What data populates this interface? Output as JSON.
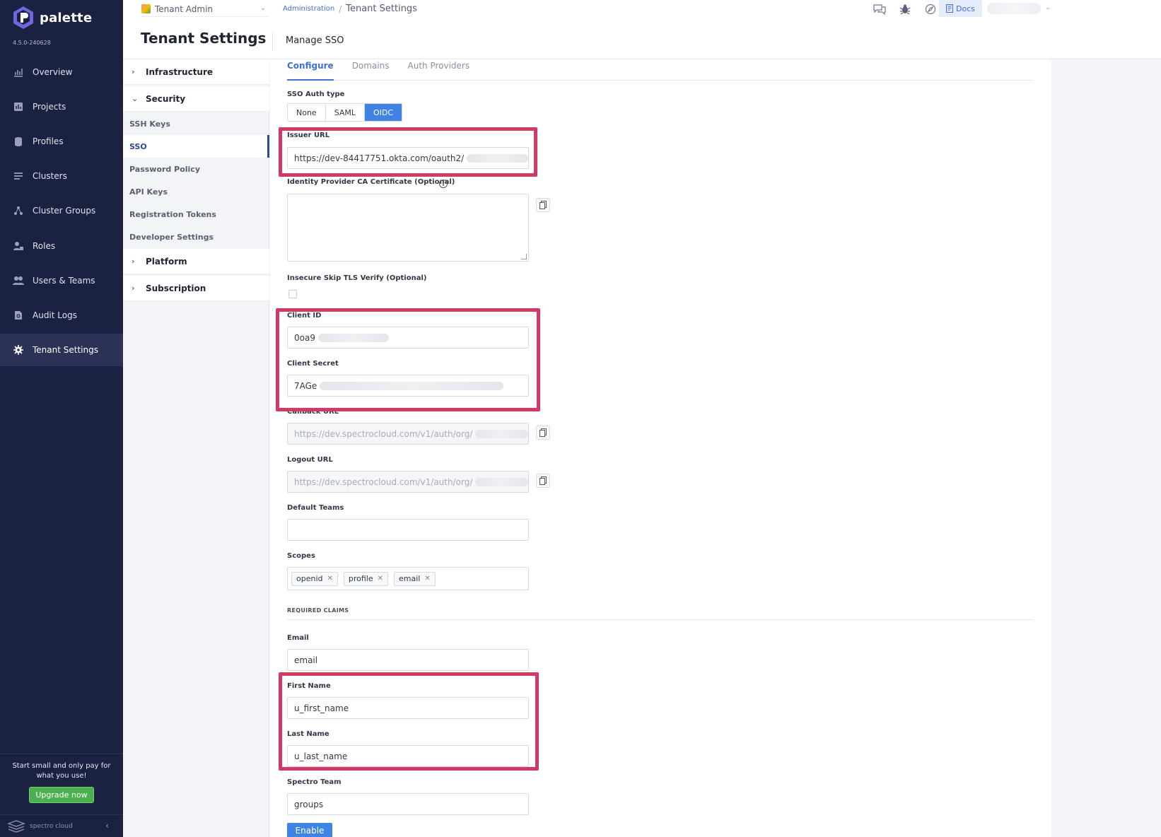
{
  "brand": {
    "name": "palette",
    "version": "4.5.0-240628"
  },
  "nav": {
    "items": [
      {
        "label": "Overview",
        "icon": "chart-icon"
      },
      {
        "label": "Projects",
        "icon": "projects-icon"
      },
      {
        "label": "Profiles",
        "icon": "stack-icon"
      },
      {
        "label": "Clusters",
        "icon": "list-icon"
      },
      {
        "label": "Cluster Groups",
        "icon": "network-icon"
      },
      {
        "label": "Roles",
        "icon": "user-lock-icon"
      },
      {
        "label": "Users & Teams",
        "icon": "users-icon"
      },
      {
        "label": "Audit Logs",
        "icon": "document-search-icon"
      },
      {
        "label": "Tenant Settings",
        "icon": "gear-icon",
        "active": true
      }
    ],
    "promo_text": "Start small and only pay for what you use!",
    "upgrade_label": "Upgrade now",
    "footer_brand": "spectro cloud"
  },
  "topbar": {
    "scope": "Tenant Admin",
    "breadcrumb_link": "Administration",
    "breadcrumb_sep": "/",
    "breadcrumb_current": "Tenant Settings",
    "docs_label": "Docs"
  },
  "header": {
    "title": "Tenant Settings",
    "section": "Manage SSO"
  },
  "menu": {
    "groups": {
      "infrastructure": "Infrastructure",
      "security": "Security",
      "platform": "Platform",
      "subscription": "Subscription"
    },
    "security_items": [
      "SSH Keys",
      "SSO",
      "Password Policy",
      "API Keys",
      "Registration Tokens",
      "Developer Settings"
    ]
  },
  "tabs": [
    "Configure",
    "Domains",
    "Auth Providers"
  ],
  "form": {
    "sso_auth_type_label": "SSO Auth type",
    "sso_auth_types": [
      "None",
      "SAML",
      "OIDC"
    ],
    "sso_auth_type_selected": "OIDC",
    "issuer_url_label": "Issuer URL",
    "issuer_url_value": "https://dev-84417751.okta.com/oauth2/",
    "ca_cert_label": "Identity Provider CA Certificate (Optional)",
    "insecure_label": "Insecure Skip TLS Verify (Optional)",
    "client_id_label": "Client ID",
    "client_id_value": "0oa9",
    "client_secret_label": "Client Secret",
    "client_secret_value": "7AGe",
    "callback_url_label": "Callback URL",
    "callback_url_value": "https://dev.spectrocloud.com/v1/auth/org/",
    "logout_url_label": "Logout URL",
    "logout_url_value": "https://dev.spectrocloud.com/v1/auth/org/",
    "default_teams_label": "Default Teams",
    "scopes_label": "Scopes",
    "scopes": [
      "openid",
      "profile",
      "email"
    ],
    "required_claims_label": "REQUIRED CLAIMS",
    "email_label": "Email",
    "email_value": "email",
    "first_name_label": "First Name",
    "first_name_value": "u_first_name",
    "last_name_label": "Last Name",
    "last_name_value": "u_last_name",
    "spectro_team_label": "Spectro Team",
    "spectro_team_value": "groups",
    "enable_label": "Enable"
  },
  "colors": {
    "nav_bg": "#1b2140",
    "accent": "#3f84e5",
    "highlight": "#d23a64"
  }
}
